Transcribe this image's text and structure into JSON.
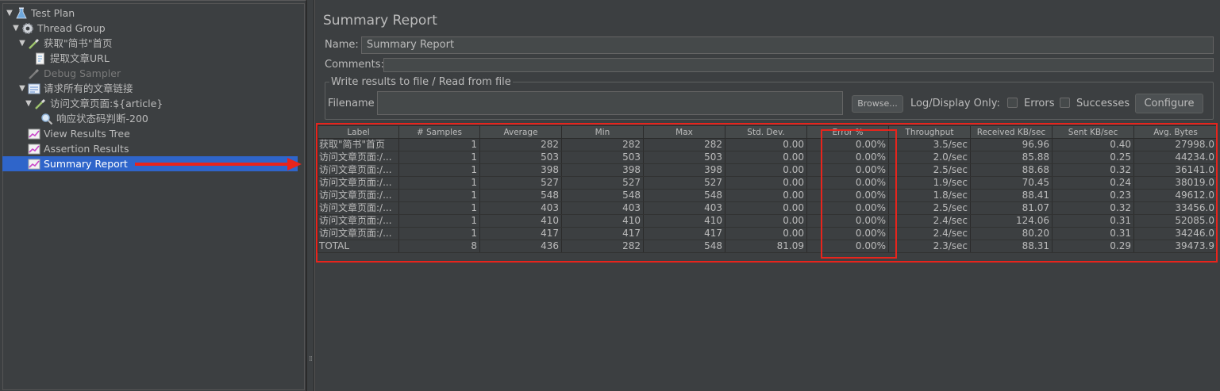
{
  "tree": {
    "items": [
      {
        "label": "Test Plan",
        "icon": "flask-icon",
        "expanded": true
      },
      {
        "label": "Thread Group",
        "icon": "gear-icon",
        "expanded": true
      },
      {
        "label": "获取\"简书\"首页",
        "icon": "pipette-icon",
        "expanded": true
      },
      {
        "label": "提取文章URL",
        "icon": "document-icon"
      },
      {
        "label": "Debug Sampler",
        "icon": "pipette-icon",
        "disabled": true
      },
      {
        "label": "请求所有的文章链接",
        "icon": "loop-controller-icon",
        "expanded": true
      },
      {
        "label": "访问文章页面:${article}",
        "icon": "pipette-icon",
        "expanded": true
      },
      {
        "label": "响应状态码判断-200",
        "icon": "magnifier-icon"
      },
      {
        "label": "View Results Tree",
        "icon": "chart-icon"
      },
      {
        "label": "Assertion Results",
        "icon": "chart-icon"
      },
      {
        "label": "Summary Report",
        "icon": "chart-icon",
        "selected": true
      }
    ]
  },
  "panel": {
    "title": "Summary Report",
    "name_label": "Name:",
    "name_value": "Summary Report",
    "comments_label": "Comments:",
    "file_legend": "Write results to file / Read from file",
    "filename_label": "Filename",
    "browse_label": "Browse...",
    "log_display_label": "Log/Display Only:",
    "errors_label": "Errors",
    "successes_label": "Successes",
    "configure_label": "Configure"
  },
  "table": {
    "columns": [
      "Label",
      "# Samples",
      "Average",
      "Min",
      "Max",
      "Std. Dev.",
      "Error %",
      "Throughput",
      "Received KB/sec",
      "Sent KB/sec",
      "Avg. Bytes"
    ],
    "rows": [
      [
        "获取\"简书\"首页",
        "1",
        "282",
        "282",
        "282",
        "0.00",
        "0.00%",
        "3.5/sec",
        "96.96",
        "0.40",
        "27998.0"
      ],
      [
        "访问文章页面:/...",
        "1",
        "503",
        "503",
        "503",
        "0.00",
        "0.00%",
        "2.0/sec",
        "85.88",
        "0.25",
        "44234.0"
      ],
      [
        "访问文章页面:/...",
        "1",
        "398",
        "398",
        "398",
        "0.00",
        "0.00%",
        "2.5/sec",
        "88.68",
        "0.32",
        "36141.0"
      ],
      [
        "访问文章页面:/...",
        "1",
        "527",
        "527",
        "527",
        "0.00",
        "0.00%",
        "1.9/sec",
        "70.45",
        "0.24",
        "38019.0"
      ],
      [
        "访问文章页面:/...",
        "1",
        "548",
        "548",
        "548",
        "0.00",
        "0.00%",
        "1.8/sec",
        "88.41",
        "0.23",
        "49612.0"
      ],
      [
        "访问文章页面:/...",
        "1",
        "403",
        "403",
        "403",
        "0.00",
        "0.00%",
        "2.5/sec",
        "81.07",
        "0.32",
        "33456.0"
      ],
      [
        "访问文章页面:/...",
        "1",
        "410",
        "410",
        "410",
        "0.00",
        "0.00%",
        "2.4/sec",
        "124.06",
        "0.31",
        "52085.0"
      ],
      [
        "访问文章页面:/...",
        "1",
        "417",
        "417",
        "417",
        "0.00",
        "0.00%",
        "2.4/sec",
        "80.20",
        "0.31",
        "34246.0"
      ],
      [
        "TOTAL",
        "8",
        "436",
        "282",
        "548",
        "81.09",
        "0.00%",
        "2.3/sec",
        "88.31",
        "0.29",
        "39473.9"
      ]
    ]
  },
  "colors": {
    "annotation": "#e8241c",
    "selection": "#2f65ca",
    "background": "#3c3f41"
  }
}
